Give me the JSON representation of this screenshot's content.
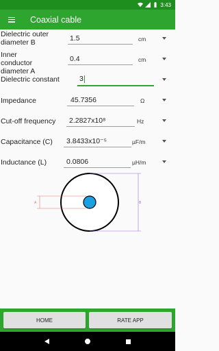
{
  "status_bar": {
    "time": "3:43"
  },
  "app_bar": {
    "title": "Coaxial cable"
  },
  "fields": {
    "dielectric_outer": {
      "label": "Dielectric outer diameter B",
      "value": "1.5",
      "unit": "cm"
    },
    "inner_conductor": {
      "label": "Inner conductor diameter A",
      "value": "0.4",
      "unit": "cm"
    },
    "dielectric_constant": {
      "label": "Dielectric constant",
      "value": "3"
    },
    "impedance": {
      "label": "Impedance",
      "value": "45.7356",
      "unit": "Ω"
    },
    "cutoff_frequency": {
      "label": "Cut-off frequency",
      "value": "2.2827x10⁸",
      "unit": "Hz"
    },
    "capacitance": {
      "label": "Capacitance (C)",
      "value": "3.8433x10⁻⁵",
      "unit": "µF/m"
    },
    "inductance": {
      "label": "Inductance (L)",
      "value": "0.0806",
      "unit": "µH/m"
    }
  },
  "diagram": {
    "label_a": "A",
    "label_b": "B",
    "outer_color": "#000000",
    "inner_color": "#1ba1e2",
    "dim_color": "#e57373",
    "dim_color_b": "#9c6fd6"
  },
  "buttons": {
    "home": "HOME",
    "rate": "RATE APP"
  },
  "colors": {
    "primary": "#2ea52e",
    "primary_dark": "#1e8e1e",
    "accent": "#1ba1e2"
  }
}
